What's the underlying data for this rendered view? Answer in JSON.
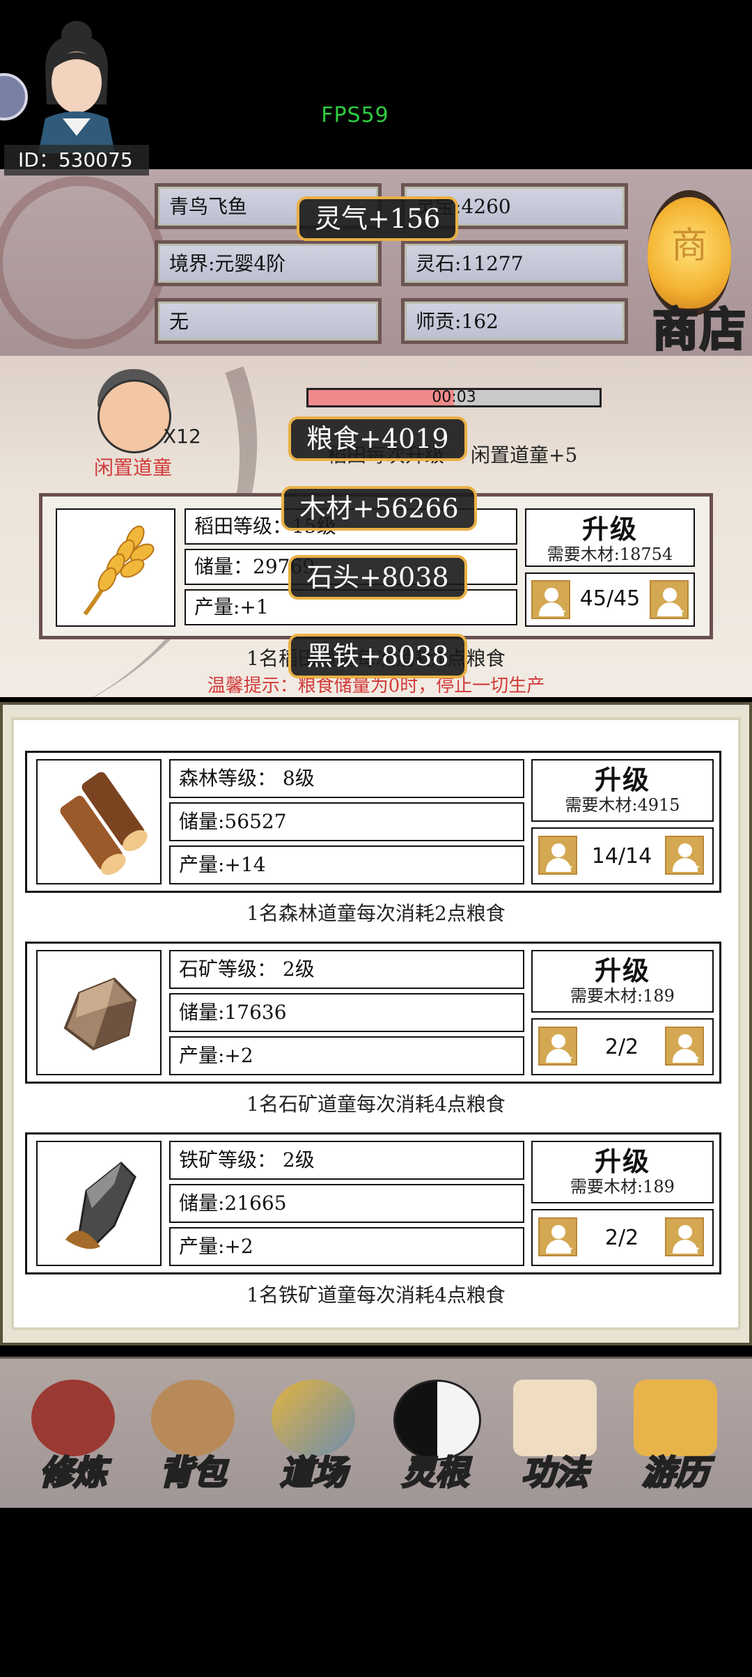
{
  "fps": "FPS59",
  "player": {
    "name": "青鸟飞鱼",
    "realm": "境界:元婴4阶",
    "sect": "无",
    "treasure": "灵宝:4260",
    "spirit_stone": "灵石:11277",
    "master_tribute": "师贡:162",
    "id": "ID：530075"
  },
  "shop": {
    "label": "商店",
    "lantern_char": "商"
  },
  "idle": {
    "count": "X12",
    "label": "闲置道童",
    "timer": "00:03",
    "timer_progress": 0.5,
    "note": "闲置道童+5",
    "hidden_note": "稻田每次升级"
  },
  "farm": {
    "level": "稻田等级：15级",
    "storage": "储量：29769",
    "output": "产量:+1",
    "upgrade": "升级",
    "cost": "需要木材:18754",
    "workers": "45/45",
    "desc": "1名稻田道童每次消耗1点粮食",
    "tip": "温馨提示：粮食储量为0时，停止一切生产"
  },
  "resources": [
    {
      "level": "森林等级： 8级",
      "storage": "储量:56527",
      "output": "产量:+14",
      "upgrade": "升级",
      "cost": "需要木材:4915",
      "workers": "14/14",
      "desc": "1名森林道童每次消耗2点粮食"
    },
    {
      "level": "石矿等级： 2级",
      "storage": "储量:17636",
      "output": "产量:+2",
      "upgrade": "升级",
      "cost": "需要木材:189",
      "workers": "2/2",
      "desc": "1名石矿道童每次消耗4点粮食"
    },
    {
      "level": "铁矿等级： 2级",
      "storage": "储量:21665",
      "output": "产量:+2",
      "upgrade": "升级",
      "cost": "需要木材:189",
      "workers": "2/2",
      "desc": "1名铁矿道童每次消耗4点粮食"
    }
  ],
  "popups": {
    "qi": "灵气+156",
    "food": "粮食+4019",
    "wood": "木材+56266",
    "stone": "石头+8038",
    "iron": "黑铁+8038"
  },
  "nav": [
    "修炼",
    "背包",
    "道场",
    "灵根",
    "功法",
    "游历"
  ],
  "colors": {
    "accent": "#e9b044",
    "warning": "#d23a3a",
    "fps": "#2ecc40"
  }
}
